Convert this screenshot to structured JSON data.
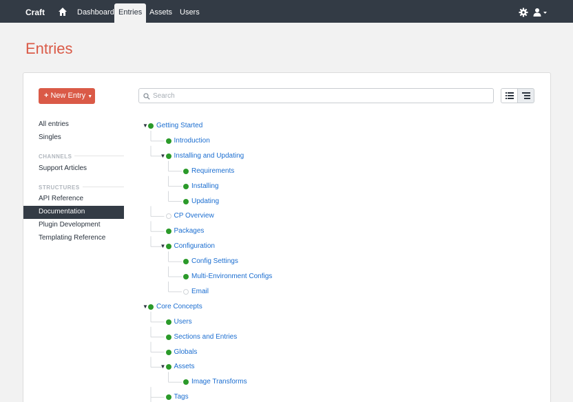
{
  "nav": {
    "brand": "Craft",
    "items": [
      "Dashboard",
      "Entries",
      "Assets",
      "Users"
    ],
    "active": "Entries"
  },
  "page": {
    "title": "Entries"
  },
  "new_entry": {
    "label": "New Entry"
  },
  "search": {
    "placeholder": "Search"
  },
  "sidebar": {
    "all_entries": "All entries",
    "singles": "Singles",
    "channels_heading": "CHANNELS",
    "channels": [
      "Support Articles"
    ],
    "structures_heading": "STRUCTURES",
    "structures": [
      "API Reference",
      "Documentation",
      "Plugin Development",
      "Templating Reference"
    ],
    "active": "Documentation"
  },
  "tree": [
    {
      "label": "Getting Started",
      "level": 0,
      "enabled": true,
      "expanded": true
    },
    {
      "label": "Introduction",
      "level": 1,
      "enabled": true
    },
    {
      "label": "Installing and Updating",
      "level": 1,
      "enabled": true,
      "expanded": true
    },
    {
      "label": "Requirements",
      "level": 2,
      "enabled": true
    },
    {
      "label": "Installing",
      "level": 2,
      "enabled": true
    },
    {
      "label": "Updating",
      "level": 2,
      "enabled": true
    },
    {
      "label": "CP Overview",
      "level": 1,
      "enabled": false
    },
    {
      "label": "Packages",
      "level": 1,
      "enabled": true
    },
    {
      "label": "Configuration",
      "level": 1,
      "enabled": true,
      "expanded": true
    },
    {
      "label": "Config Settings",
      "level": 2,
      "enabled": true
    },
    {
      "label": "Multi-Environment Configs",
      "level": 2,
      "enabled": true
    },
    {
      "label": "Email",
      "level": 2,
      "enabled": false
    },
    {
      "label": "Core Concepts",
      "level": 0,
      "enabled": true,
      "expanded": true
    },
    {
      "label": "Users",
      "level": 1,
      "enabled": true
    },
    {
      "label": "Sections and Entries",
      "level": 1,
      "enabled": true
    },
    {
      "label": "Globals",
      "level": 1,
      "enabled": true
    },
    {
      "label": "Assets",
      "level": 1,
      "enabled": true,
      "expanded": true
    },
    {
      "label": "Image Transforms",
      "level": 2,
      "enabled": true
    },
    {
      "label": "Tags",
      "level": 1,
      "enabled": true
    }
  ],
  "colors": {
    "nav_bg": "#333b45",
    "accent": "#da5a47",
    "link": "#1a6dd0",
    "enabled_dot": "#2b9a2a"
  },
  "icons": [
    "home-icon",
    "gear-icon",
    "user-icon",
    "search-icon",
    "list-view-icon",
    "structure-view-icon"
  ]
}
